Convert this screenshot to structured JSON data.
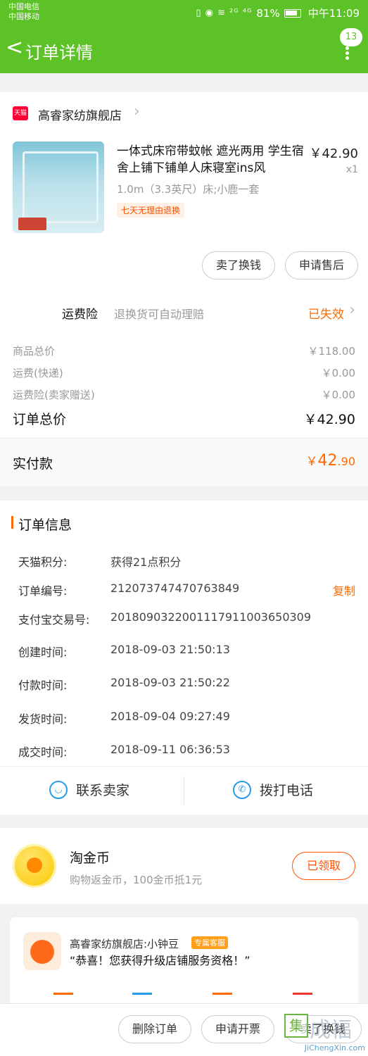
{
  "status_bar": {
    "carrier1": "中国电信",
    "carrier2": "中国移动",
    "icons": "▯ ◉ ≋ ²ᴳ ⁴ᴳ",
    "battery": "81%",
    "time": "中午11:09"
  },
  "nav": {
    "back_icon": "<",
    "title": "订单详情",
    "badge": "13"
  },
  "shop": {
    "logo": "天猫",
    "name": "高睿家纺旗舰店"
  },
  "product": {
    "title": "一体式床帘带蚊帐 遮光两用 学生宿舍上铺下铺单人床寝室ins风",
    "price": "￥42.90",
    "qty": "x1",
    "spec": "1.0m（3.3英尺）床;小鹿一套",
    "tag": "七天无理由退换"
  },
  "item_actions": {
    "sell": "卖了换钱",
    "after_sale": "申请售后"
  },
  "insurance": {
    "label": "运费险",
    "desc": "退换货可自动理赔",
    "status": "已失效"
  },
  "summary": {
    "goods_label": "商品总价",
    "goods_value": "￥118.00",
    "shipping_label": "运费(快递)",
    "shipping_value": "￥0.00",
    "ins_label": "运费险(卖家赠送)",
    "ins_value": "￥0.00",
    "total_label": "订单总价",
    "total_value": "￥42.90",
    "paid_label": "实付款",
    "paid_currency": "￥",
    "paid_int": "42",
    "paid_dec": ".90"
  },
  "order_info": {
    "title": "订单信息",
    "rows": [
      {
        "label": "天猫积分:",
        "value": "获得21点积分"
      },
      {
        "label": "订单编号:",
        "value": "212073747470763849"
      },
      {
        "label": "支付宝交易号:",
        "value": "2018090322001117911003650309"
      },
      {
        "label": "创建时间:",
        "value": "2018-09-03 21:50:13"
      },
      {
        "label": "付款时间:",
        "value": "2018-09-03 21:50:22"
      },
      {
        "label": "发货时间:",
        "value": "2018-09-04 09:27:49"
      },
      {
        "label": "成交时间:",
        "value": "2018-09-11 06:36:53"
      }
    ],
    "copy": "复制"
  },
  "contact": {
    "seller": "联系卖家",
    "phone": "拨打电话"
  },
  "coins": {
    "title": "淘金币",
    "desc": "购物返金币，100金币抵1元",
    "button": "已领取"
  },
  "service": {
    "name": "高睿家纺旗舰店:小钟豆",
    "tag": "专属客服",
    "message": "“恭喜！您获得升级店铺服务资格！”"
  },
  "bottom": {
    "delete": "删除订单",
    "invoice": "申请开票",
    "sell": "卖了换钱"
  },
  "watermark": {
    "box": "集",
    "big": "成福",
    "url": "JiChengXin.com"
  },
  "colors": {
    "brand_green": "#5cc227",
    "accent_orange": "#ff6a00",
    "tmall_red": "#ff0036"
  }
}
